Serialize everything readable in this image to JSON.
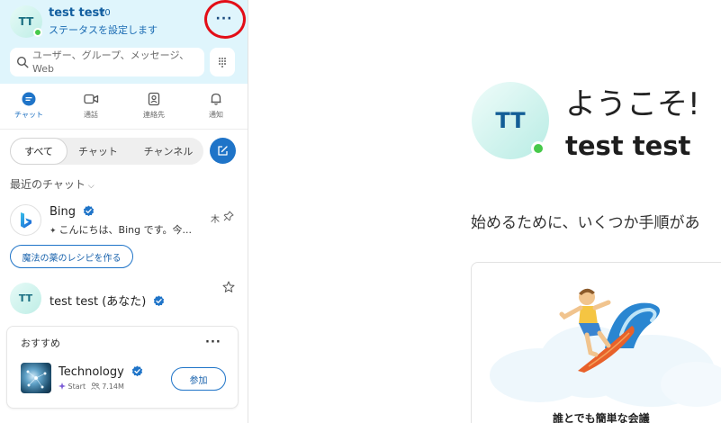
{
  "profile": {
    "initials": "TT",
    "name": "test test",
    "credit": "¥0",
    "status_prompt": "ステータスを設定します",
    "more_label": "···"
  },
  "search": {
    "placeholder": "ユーザー、グループ、メッセージ、Web"
  },
  "nav": {
    "items": [
      {
        "label": "チャット",
        "icon": "chat-icon",
        "active": true
      },
      {
        "label": "通話",
        "icon": "video-icon"
      },
      {
        "label": "連絡先",
        "icon": "contacts-icon"
      },
      {
        "label": "通知",
        "icon": "bell-icon"
      }
    ]
  },
  "filters": {
    "tabs": [
      "すべて",
      "チャット",
      "チャンネル"
    ],
    "active": "すべて"
  },
  "recent_header": "最近のチャット",
  "chats": [
    {
      "name": "Bing",
      "preview": "こんにちは、Bing です。今...",
      "day": "木",
      "action": "魔法の薬のレシピを作る"
    },
    {
      "initials": "TT",
      "name": "test test (あなた)"
    }
  ],
  "recommend": {
    "title": "おすすめ",
    "more_label": "···",
    "channel_name": "Technology",
    "meta_source": "Start",
    "meta_count": "7.14M",
    "join_label": "参加"
  },
  "main": {
    "initials": "TT",
    "welcome": "ようこそ!",
    "user_name": "test test",
    "start_text": "始めるために、いくつか手順があ",
    "card_caption": "誰とでも簡単な会議"
  },
  "colors": {
    "accent": "#1f74c8",
    "header_bg": "#dff5fc",
    "presence": "#47c94a",
    "highlight": "#e30e17"
  }
}
